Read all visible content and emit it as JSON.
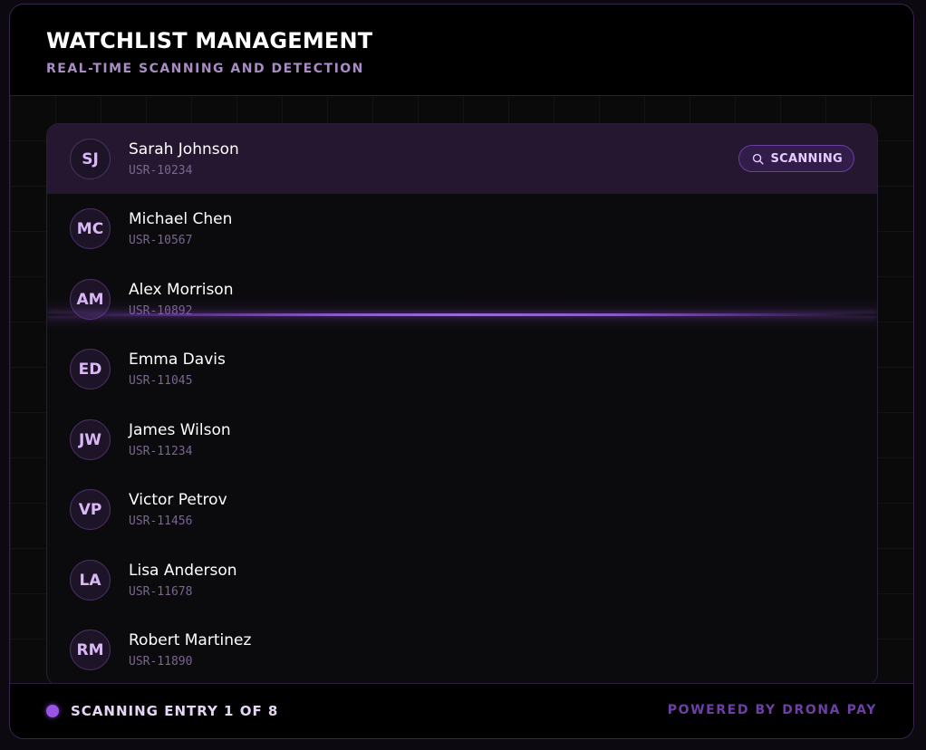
{
  "header": {
    "title": "WATCHLIST MANAGEMENT",
    "subtitle": "REAL-TIME SCANNING AND DETECTION"
  },
  "entries": [
    {
      "initials": "SJ",
      "name": "Sarah Johnson",
      "id": "USR-10234",
      "active": true,
      "badge": "SCANNING"
    },
    {
      "initials": "MC",
      "name": "Michael Chen",
      "id": "USR-10567"
    },
    {
      "initials": "AM",
      "name": "Alex Morrison",
      "id": "USR-10892"
    },
    {
      "initials": "ED",
      "name": "Emma Davis",
      "id": "USR-11045"
    },
    {
      "initials": "JW",
      "name": "James Wilson",
      "id": "USR-11234"
    },
    {
      "initials": "VP",
      "name": "Victor Petrov",
      "id": "USR-11456"
    },
    {
      "initials": "LA",
      "name": "Lisa Anderson",
      "id": "USR-11678"
    },
    {
      "initials": "RM",
      "name": "Robert Martinez",
      "id": "USR-11890"
    }
  ],
  "icons": {
    "badge": "search-icon",
    "status": "status-dot-icon"
  },
  "colors": {
    "accent": "#9a55e6",
    "active_row": "#25172f",
    "brand": "#6e3fa6"
  },
  "footer": {
    "status": "SCANNING ENTRY 1 OF 8",
    "powered_by": "POWERED BY DRONA PAY"
  }
}
